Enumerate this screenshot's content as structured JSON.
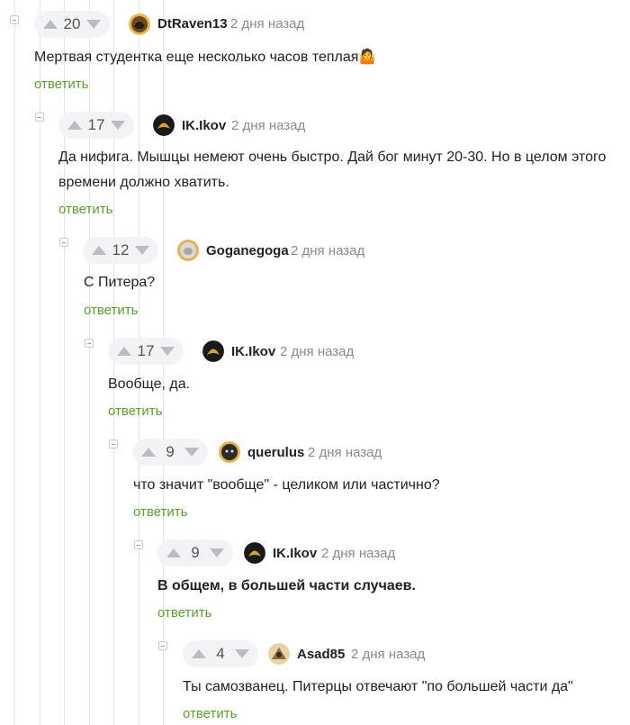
{
  "comments": [
    {
      "score": "20",
      "username": "DtRaven13",
      "time": "2 дня назад",
      "text": "Мертвая студентка еще несколько часов теплая🤷",
      "reply": "ответить",
      "avatar_color": "#6b4a2a"
    },
    {
      "score": "17",
      "username": "IK.Ikov",
      "time": "2 дня назад",
      "text": "Да нифига. Мышцы немеют очень быстро. Дай бог минут 20-30. Но в целом этого времени должно хватить.",
      "reply": "ответить",
      "avatar_color": "#1a1a1a"
    },
    {
      "score": "12",
      "username": "Goganegoga",
      "time": "2 дня назад",
      "text": "С Питера?",
      "reply": "ответить",
      "avatar_color": "#cfcfcf"
    },
    {
      "score": "17",
      "username": "IK.Ikov",
      "time": "2 дня назад",
      "text": "Вообще, да.",
      "reply": "ответить",
      "avatar_color": "#1a1a1a"
    },
    {
      "score": "9",
      "username": "querulus",
      "time": "2 дня назад",
      "text": "что значит \"вообще\" - целиком или частично?",
      "reply": "ответить",
      "avatar_color": "#2b2b2b"
    },
    {
      "score": "9",
      "username": "IK.Ikov",
      "time": "2 дня назад",
      "text": "В общем, в большей части случаев.",
      "reply": "ответить",
      "avatar_color": "#1a1a1a"
    },
    {
      "score": "4",
      "username": "Asad85",
      "time": "2 дня назад",
      "text": "Ты самозванец. Питерцы отвечают \"по большей части да\"",
      "reply": "ответить",
      "avatar_color": "#b8955a"
    }
  ]
}
